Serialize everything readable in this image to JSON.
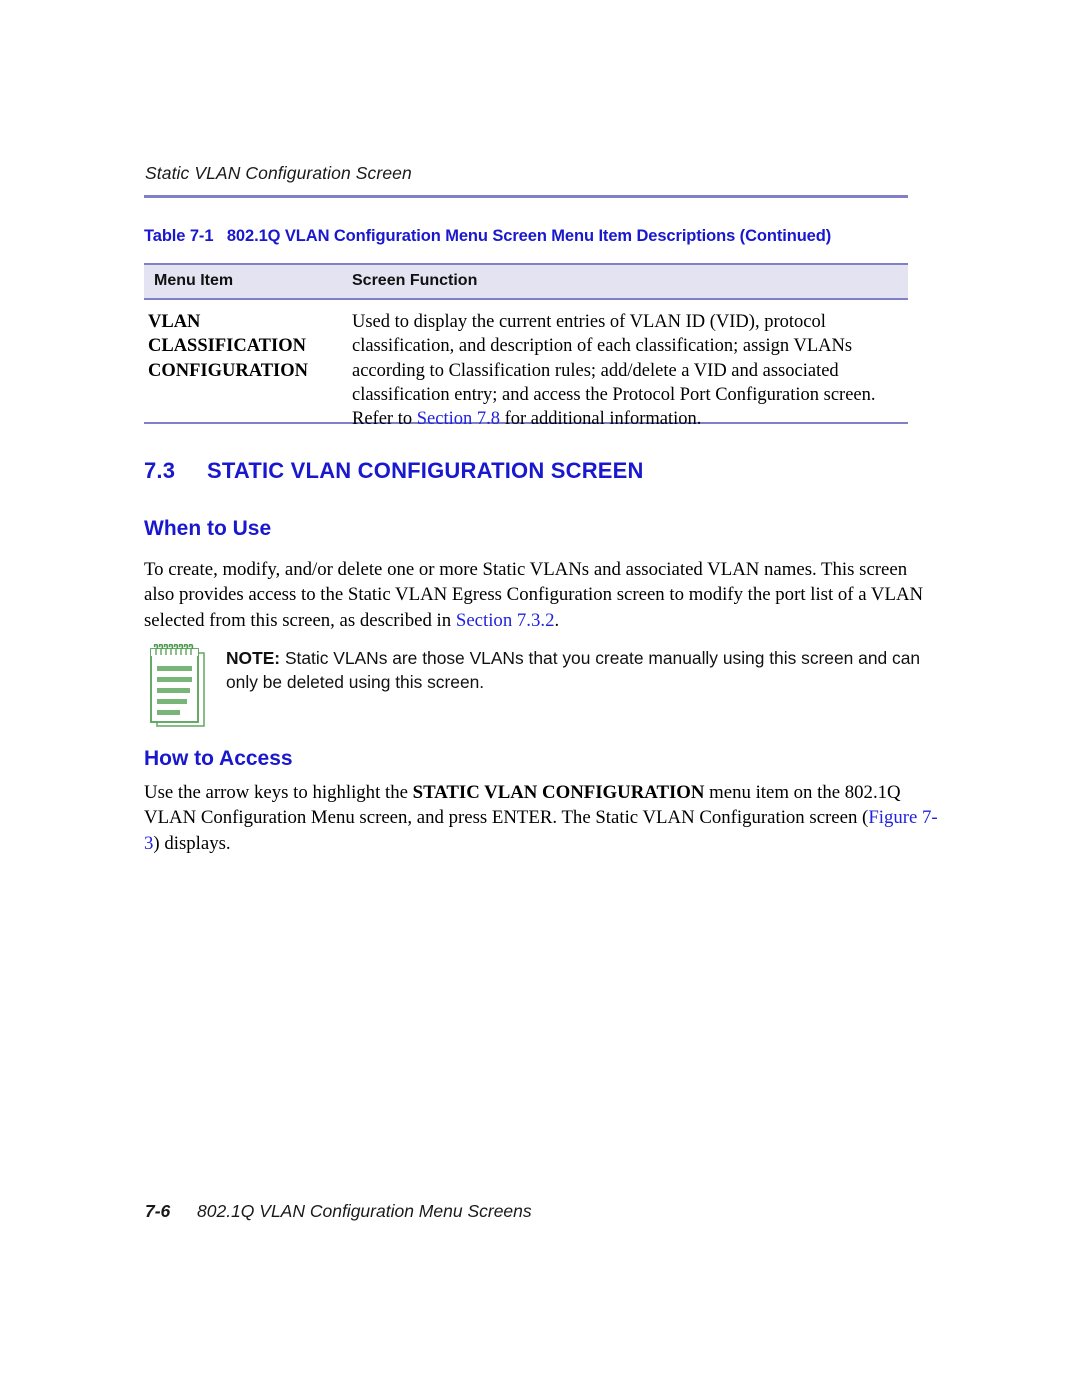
{
  "running_header": "Static VLAN Configuration Screen",
  "table": {
    "caption_label": "Table 7-1",
    "caption_title": "802.1Q VLAN Configuration Menu Screen Menu Item Descriptions (Continued)",
    "columns": [
      "Menu Item",
      "Screen Function"
    ],
    "rows": [
      {
        "menu_item": "VLAN CLASSIFICATION CONFIGURATION",
        "screen_function_pre": "Used to display the current entries of VLAN ID (VID), protocol classification, and description of each classification; assign VLANs according to Classification rules; add/delete a VID and associated classification entry; and access the Protocol Port Configuration screen. Refer to ",
        "screen_function_link": "Section 7.8",
        "screen_function_post": " for additional information."
      }
    ]
  },
  "section": {
    "number": "7.3",
    "title": "STATIC VLAN CONFIGURATION SCREEN"
  },
  "when_to_use": {
    "heading": "When to Use",
    "body_pre": "To create, modify, and/or delete one or more Static VLANs and associated VLAN names. This screen also provides access to the Static VLAN Egress Configuration screen to modify the port list of a VLAN selected from this screen, as described in ",
    "body_link": "Section 7.3.2",
    "body_post": "."
  },
  "note": {
    "icon": "notepad-icon",
    "label": "NOTE:",
    "text": " Static VLANs are those VLANs that you create manually using this screen and can only be deleted using this screen.",
    "accent_color": "#6aab6a"
  },
  "how_to_access": {
    "heading": "How to Access",
    "body_pre": "Use the arrow keys to highlight the ",
    "body_bold": "STATIC VLAN CONFIGURATION",
    "body_mid": " menu item on the 802.1Q VLAN Configuration Menu screen, and press ENTER. The Static VLAN Configuration screen (",
    "body_link": "Figure 7-3",
    "body_post": ") displays."
  },
  "footer": {
    "page_number": "7-6",
    "chapter_title": "802.1Q VLAN Configuration Menu Screens"
  },
  "colors": {
    "heading_blue": "#1a18cf",
    "link_blue": "#2222dd",
    "rule_violet": "#8080c8",
    "table_header_bg": "#e3e3f2"
  }
}
